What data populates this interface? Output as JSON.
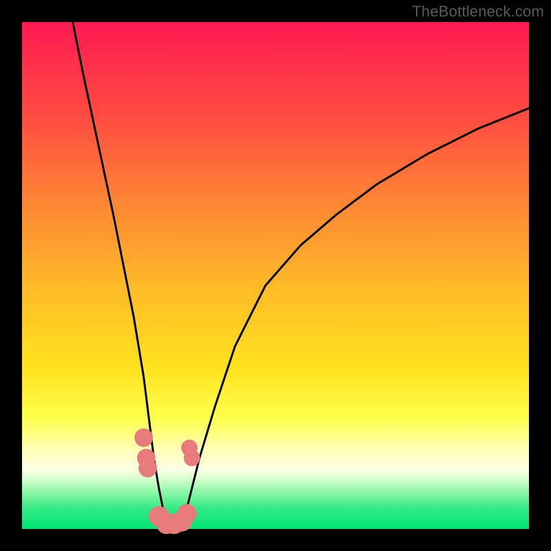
{
  "watermark": "TheBottleneck.com",
  "chart_data": {
    "type": "line",
    "title": "",
    "xlabel": "",
    "ylabel": "",
    "xlim": [
      0,
      100
    ],
    "ylim": [
      0,
      100
    ],
    "series": [
      {
        "name": "bottleneck-curve",
        "x": [
          10,
          12,
          15,
          18,
          20,
          22,
          24,
          25,
          26,
          27,
          28,
          29,
          30,
          31,
          32,
          33,
          35,
          38,
          42,
          48,
          55,
          62,
          70,
          80,
          90,
          100
        ],
        "y": [
          100,
          90,
          76,
          62,
          52,
          42,
          30,
          22,
          14,
          8,
          3,
          0,
          0,
          0,
          2,
          6,
          14,
          24,
          36,
          48,
          56,
          62,
          68,
          74,
          79,
          83
        ]
      }
    ],
    "markers": [
      {
        "name": "marker-left-1",
        "x": 24.0,
        "y": 18,
        "r": 2.0
      },
      {
        "name": "marker-left-2",
        "x": 24.5,
        "y": 14,
        "r": 2.0
      },
      {
        "name": "marker-left-3",
        "x": 24.8,
        "y": 12,
        "r": 2.0
      },
      {
        "name": "marker-right-1",
        "x": 33.0,
        "y": 16,
        "r": 1.6
      },
      {
        "name": "marker-right-2",
        "x": 33.5,
        "y": 14,
        "r": 1.6
      },
      {
        "name": "marker-bottom-1",
        "x": 27.0,
        "y": 2.5,
        "r": 2.4
      },
      {
        "name": "marker-bottom-2",
        "x": 28.5,
        "y": 1.0,
        "r": 2.4
      },
      {
        "name": "marker-bottom-3",
        "x": 30.0,
        "y": 1.0,
        "r": 2.4
      },
      {
        "name": "marker-bottom-4",
        "x": 31.5,
        "y": 1.5,
        "r": 2.4
      },
      {
        "name": "marker-bottom-5",
        "x": 32.5,
        "y": 3.0,
        "r": 2.2
      }
    ],
    "colors": {
      "curve": "#000000",
      "marker": "#e77a7a"
    }
  }
}
